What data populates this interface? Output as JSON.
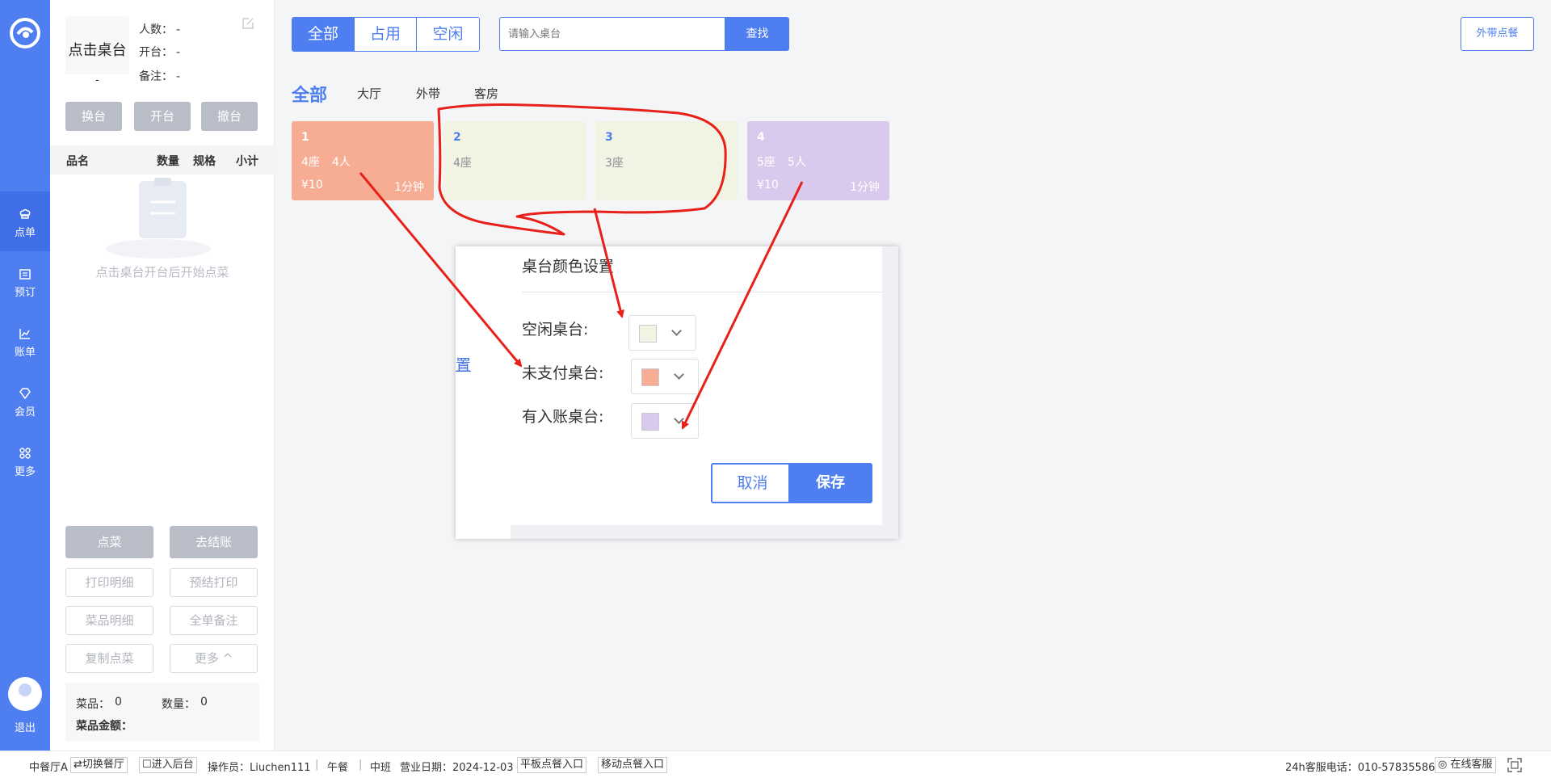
{
  "nav": {
    "items": [
      {
        "label": "点单",
        "icon": "chef-hat-icon",
        "active": true
      },
      {
        "label": "预订",
        "icon": "calendar-icon",
        "active": false
      },
      {
        "label": "账单",
        "icon": "chart-icon",
        "active": false
      },
      {
        "label": "会员",
        "icon": "diamond-icon",
        "active": false
      },
      {
        "label": "更多",
        "icon": "grid-icon",
        "active": false
      }
    ],
    "exit_label": "退出"
  },
  "order": {
    "table_title": "点击桌台",
    "table_sub": "-",
    "people_label": "人数：",
    "people_value": "-",
    "open_label": "开台：",
    "open_value": "-",
    "note_label": "备注：",
    "note_value": "-",
    "buttons": {
      "switch": "换台",
      "open": "开台",
      "cancel": "撤台"
    },
    "columns": {
      "name": "品名",
      "qty": "数量",
      "spec": "规格",
      "subtotal": "小计"
    },
    "empty_text": "点击桌台开台后开始点菜",
    "actions": {
      "order": "点菜",
      "checkout": "去结账",
      "print_detail": "打印明细",
      "pre_print": "预结打印",
      "dish_detail": "菜品明细",
      "order_note": "全单备注",
      "copy_order": "复制点菜",
      "more": "更多 ^"
    },
    "summary": {
      "dishes_label": "菜品：",
      "dishes_value": "0",
      "qty_label": "数量：",
      "qty_value": "0",
      "amount_label": "菜品金额："
    }
  },
  "filter": {
    "tabs": [
      {
        "label": "全部",
        "active": true
      },
      {
        "label": "占用",
        "active": false
      },
      {
        "label": "空闲",
        "active": false
      }
    ],
    "search_placeholder": "请输入桌台",
    "search_button": "查找",
    "takeout_button": "外带点餐"
  },
  "areas": [
    {
      "label": "全部",
      "active": true
    },
    {
      "label": "大厅",
      "active": false
    },
    {
      "label": "外带",
      "active": false
    },
    {
      "label": "客房",
      "active": false
    }
  ],
  "tables": [
    {
      "no": "1",
      "seats": "4座",
      "people": "4人",
      "amount": "¥10",
      "duration": "1分钟",
      "status": "unpaid",
      "color": "#f6ad93"
    },
    {
      "no": "2",
      "seats": "4座",
      "people": "",
      "amount": "",
      "duration": "",
      "status": "free",
      "color": "#f1f4e3"
    },
    {
      "no": "3",
      "seats": "3座",
      "people": "",
      "amount": "",
      "duration": "",
      "status": "free",
      "color": "#f1f4e3"
    },
    {
      "no": "4",
      "seats": "5座",
      "people": "5人",
      "amount": "¥10",
      "duration": "1分钟",
      "status": "booked",
      "color": "#d9c9ec"
    }
  ],
  "dialog": {
    "title": "桌台颜色设置",
    "bg_link": "置",
    "free_label": "空闲桌台:",
    "free_color": "#f1f4e3",
    "unpaid_label": "未支付桌台:",
    "unpaid_color": "#f6ad93",
    "booked_label": "有入账桌台:",
    "booked_color": "#d9c9ec",
    "cancel": "取消",
    "save": "保存"
  },
  "footer": {
    "restaurant": "中餐厅A",
    "switch_restaurant": "⇄切换餐厅",
    "backend": "☐进入后台",
    "operator": "操作员：Liuchen111",
    "meal": "午餐",
    "shift": "中班",
    "business_date": "营业日期：2024-12-03",
    "tablet_entry": "平板点餐入口",
    "mobile_entry": "移动点餐入口",
    "hotline": "24h客服电话：010-57835586",
    "online_service": "在线客服"
  },
  "colors": {
    "accent": "#4f7ef0",
    "annotation": "#e8201a"
  }
}
